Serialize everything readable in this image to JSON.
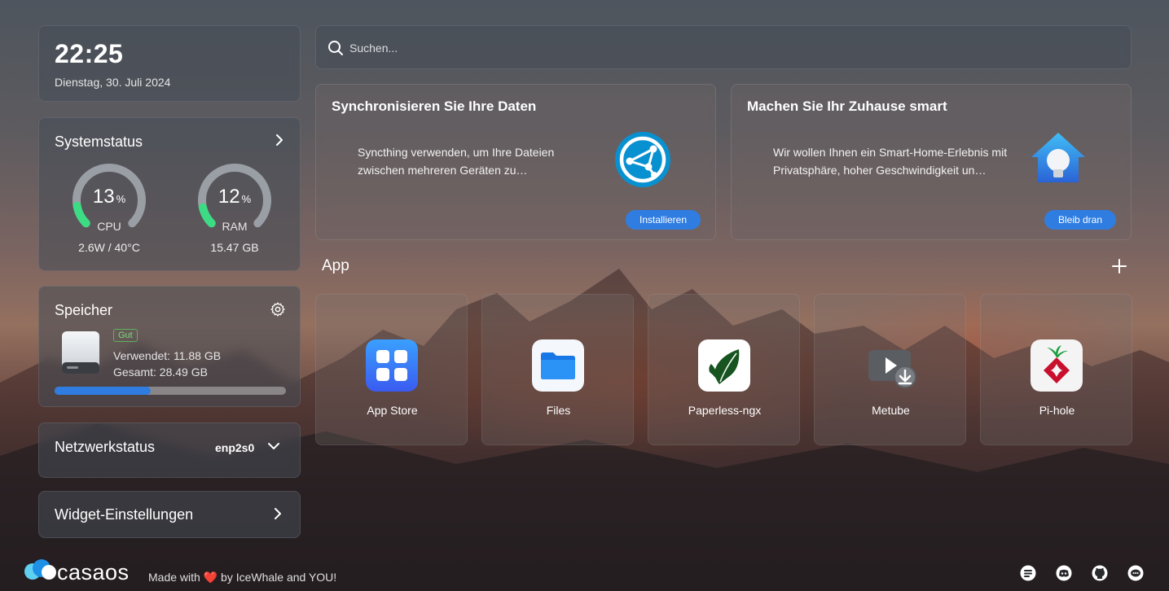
{
  "clock": {
    "time": "22:25",
    "date": "Dienstag, 30. Juli 2024"
  },
  "system_status": {
    "title": "Systemstatus",
    "cpu": {
      "value": "13",
      "unit": "%",
      "label": "CPU",
      "detail": "2.6W / 40°C",
      "fraction": 0.13
    },
    "ram": {
      "value": "12",
      "unit": "%",
      "label": "RAM",
      "detail": "15.47 GB",
      "fraction": 0.12
    }
  },
  "storage": {
    "title": "Speicher",
    "badge": "Gut",
    "used": "Verwendet: 11.88 GB",
    "total": "Gesamt: 28.49 GB",
    "used_fraction": 0.417
  },
  "network": {
    "title": "Netzwerkstatus",
    "interface": "enp2s0"
  },
  "widget_settings": {
    "title": "Widget-Einstellungen"
  },
  "search": {
    "placeholder": "Suchen..."
  },
  "promos": [
    {
      "title": "Synchronisieren Sie Ihre Daten",
      "text": "Syncthing verwenden, um Ihre Dateien zwischen mehreren Geräten zu…",
      "button": "Installieren",
      "icon": "syncthing-icon"
    },
    {
      "title": "Machen Sie Ihr Zuhause smart",
      "text": "Wir wollen Ihnen ein Smart-Home-Erlebnis mit Privatsphäre, hoher Geschwindigkeit un…",
      "button": "Bleib dran",
      "icon": "home-assistant-icon"
    }
  ],
  "apps_section": {
    "title": "App"
  },
  "apps": [
    {
      "label": "App Store",
      "icon": "app-store-icon"
    },
    {
      "label": "Files",
      "icon": "folder-icon"
    },
    {
      "label": "Paperless-ngx",
      "icon": "leaf-icon"
    },
    {
      "label": "Metube",
      "icon": "video-download-icon"
    },
    {
      "label": "Pi-hole",
      "icon": "pihole-icon"
    }
  ],
  "footer": {
    "logo": "casaos",
    "made_with_prefix": "Made with",
    "made_with_suffix": "by IceWhale and YOU!",
    "icons": [
      "message-icon",
      "discord-icon",
      "github-icon",
      "chat-icon"
    ]
  },
  "colors": {
    "accent": "#2f7de1",
    "gauge_track": "#9a9ea5",
    "gauge_fill": "#3ddc84",
    "badge_green": "#5db35d"
  }
}
